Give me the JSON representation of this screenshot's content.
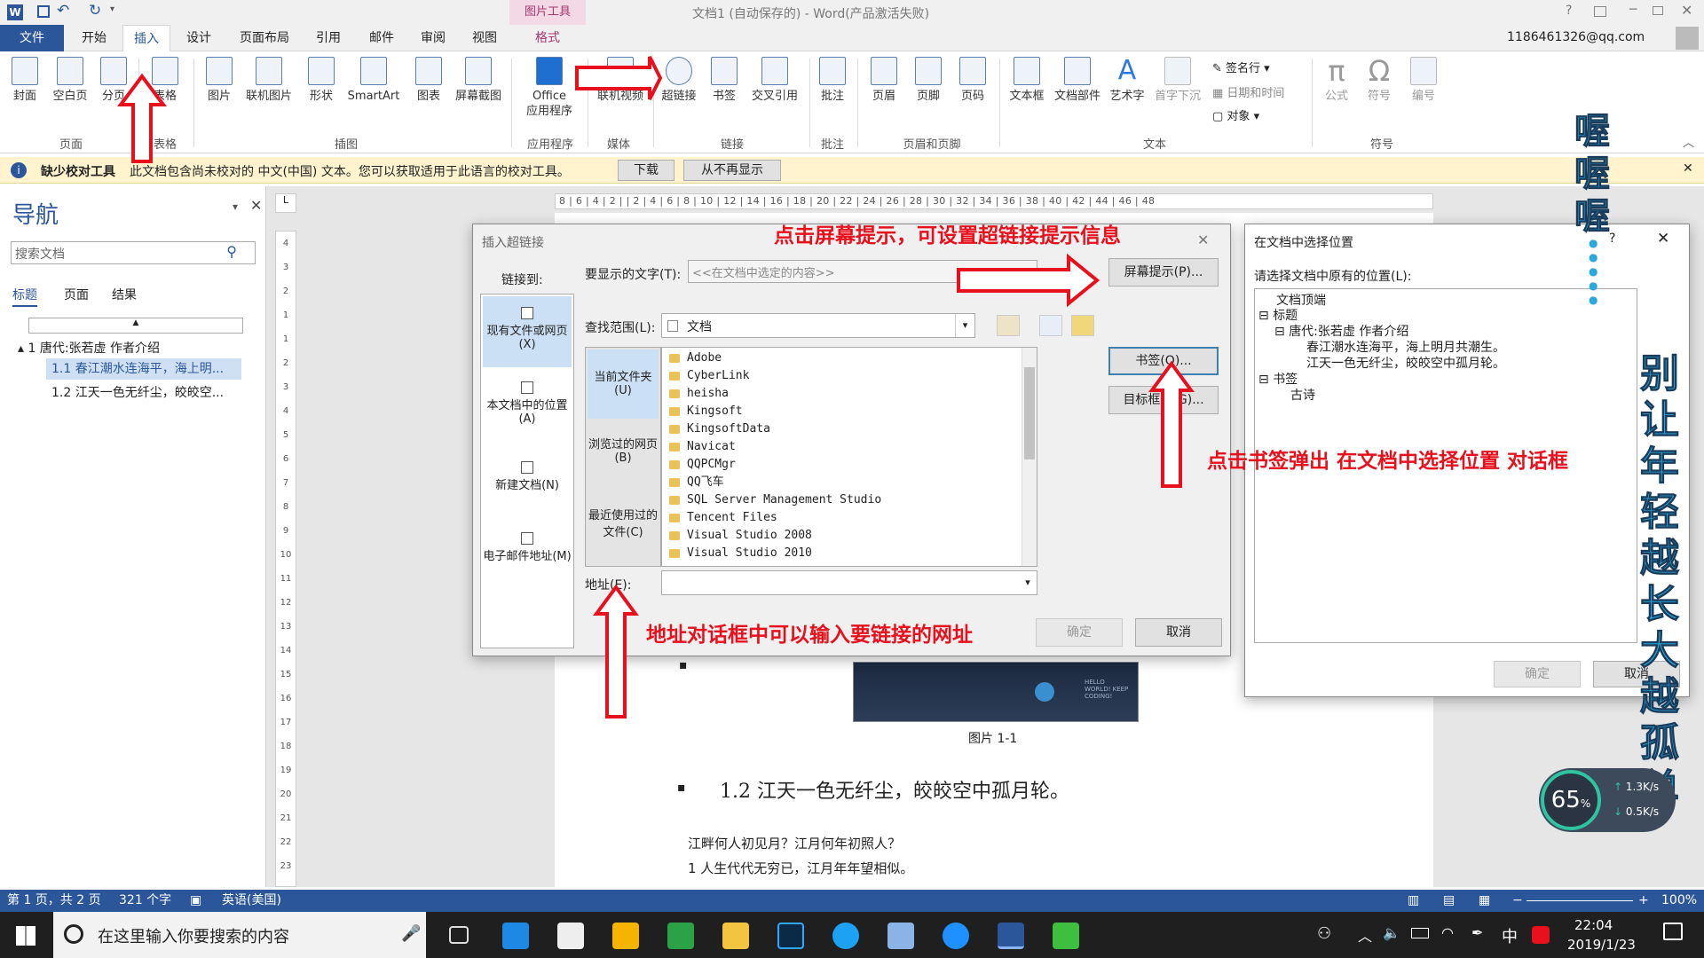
{
  "window": {
    "title": "文档1 (自动保存的) - Word(产品激活失败)",
    "picture_tools": "图片工具",
    "account": "1186461326@qq.com",
    "help": "?"
  },
  "tabs": [
    "文件",
    "开始",
    "插入",
    "设计",
    "页面布局",
    "引用",
    "邮件",
    "审阅",
    "视图",
    "格式"
  ],
  "ribbon": {
    "buttons": [
      "封面",
      "空白页",
      "分页",
      "表格",
      "图片",
      "联机图片",
      "形状",
      "SmartArt",
      "图表",
      "屏幕截图",
      "Office\n应用程序",
      "联机视频",
      "超链接",
      "书签",
      "交叉引用",
      "批注",
      "页眉",
      "页脚",
      "页码",
      "文本框",
      "文档部件",
      "艺术字",
      "首字下沉",
      "公式",
      "符号",
      "编号"
    ],
    "small": [
      "签名行",
      "日期和时间",
      "对象"
    ],
    "groups": [
      "页面",
      "表格",
      "插图",
      "应用程序",
      "媒体",
      "链接",
      "批注",
      "页眉和页脚",
      "文本",
      "符号"
    ]
  },
  "message_bar": {
    "title": "缺少校对工具",
    "text": "此文档包含尚未校对的 中文(中国) 文本。您可以获取适用于此语言的校对工具。",
    "download": "下载",
    "never": "从不再显示"
  },
  "nav": {
    "title": "导航",
    "search_placeholder": "搜索文档",
    "tabs": [
      "标题",
      "页面",
      "结果"
    ],
    "items": [
      "1 唐代:张若虚 作者介绍",
      "1.1 春江潮水连海平，海上明...",
      "1.2 江天一色无纤尘，皎皎空..."
    ]
  },
  "ruler": {
    "h": "8 | 6 | 4 | 2 | | 2 | 4 | 6 | 8 | 10 | 12 | 14 | 16 | 18 | 20 | 22 | 24 | 26 | 28 | 30 | 32 | 34 | 36 | 38 | 40 | 42 | 44 | 46 | 48",
    "v": [
      "4",
      "3",
      "2",
      "1",
      "1",
      "2",
      "3",
      "4",
      "5",
      "6",
      "7",
      "8",
      "9",
      "10",
      "11",
      "12",
      "13",
      "14",
      "15",
      "16",
      "17",
      "18",
      "19",
      "20",
      "21",
      "22",
      "23"
    ]
  },
  "document": {
    "caption": "图片 1-1",
    "heading": "1.2 江天一色无纤尘，皎皎空中孤月轮。",
    "line1": "江畔何人初见月？江月何年初照人？",
    "line2": "1 人生代代无穷已，江月年年望相似。",
    "image_text": "HELLO WORLD! KEEP CODING!"
  },
  "hyperlink_dialog": {
    "title": "插入超链接",
    "link_to": "链接到:",
    "link_options": [
      "现有文件或网页(X)",
      "本文档中的位置(A)",
      "新建文档(N)",
      "电子邮件地址(M)"
    ],
    "display_text_label": "要显示的文字(T):",
    "display_text_value": "<<在文档中选定的内容>>",
    "screentip": "屏幕提示(P)...",
    "lookin_label": "查找范围(L):",
    "lookin_value": "文档",
    "side_tabs": [
      "当前文件夹(U)",
      "浏览过的网页(B)",
      "最近使用过的文件(C)"
    ],
    "files": [
      "Adobe",
      "CyberLink",
      "heisha",
      "Kingsoft",
      "KingsoftData",
      "Navicat",
      "QQPCMgr",
      "QQ飞车",
      "SQL Server Management Studio",
      "Tencent Files",
      "Visual Studio 2008",
      "Visual Studio 2010"
    ],
    "bookmark": "书签(O)...",
    "target_frame": "目标框架(G)...",
    "address_label": "地址(E):",
    "address_value": "",
    "ok": "确定",
    "cancel": "取消"
  },
  "place_dialog": {
    "title": "在文档中选择位置",
    "label": "请选择文档中原有的位置(L):",
    "tree": [
      "文档顶端",
      "标题",
      "唐代:张若虚 作者介绍",
      "春江潮水连海平，海上明月共潮生。",
      "江天一色无纤尘，皎皎空中孤月轮。",
      "书签",
      "古诗"
    ],
    "ok": "确定",
    "cancel": "取消"
  },
  "annotations": {
    "screentip_note": "点击屏幕提示，可设置超链接提示信息",
    "bookmark_note": "点击书签弹出 在文档中选择位置 对话框",
    "address_note": "地址对话框中可以输入要链接的网址",
    "side_top": "喔喔喔",
    "side_right": "别让年轻越长大越孤单"
  },
  "widget": {
    "percent": "65",
    "unit": "%",
    "up": "1.3K/s",
    "down": "0.5K/s"
  },
  "status": {
    "page": "第 1 页，共 2 页",
    "words": "321 个字",
    "lang": "英语(美国)",
    "zoom": "100%"
  },
  "taskbar": {
    "search": "在这里输入你要搜索的内容",
    "time": "22:04",
    "date": "2019/1/23",
    "ime": "中"
  }
}
